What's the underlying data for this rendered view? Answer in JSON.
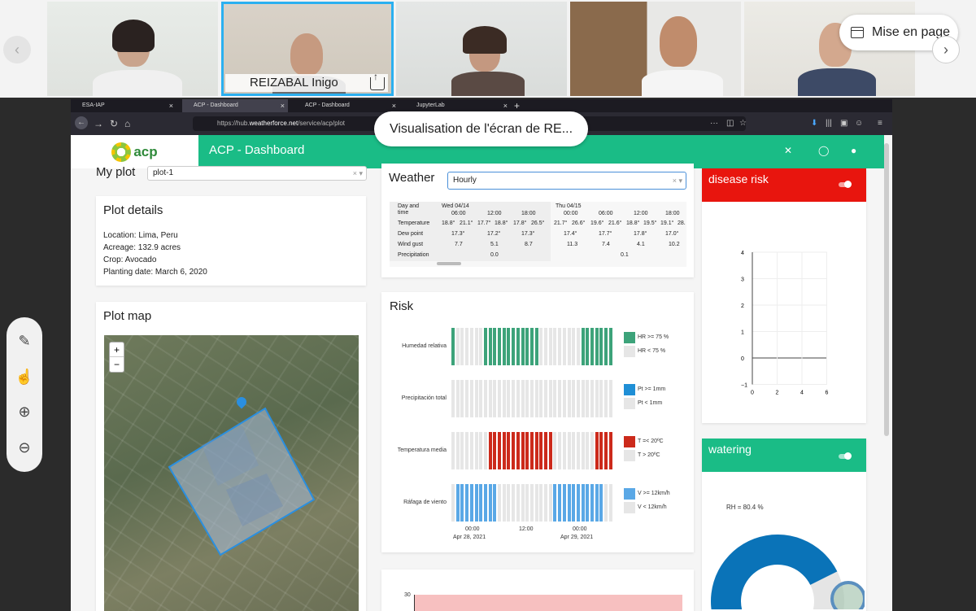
{
  "meeting": {
    "participants": [
      {
        "name": ""
      },
      {
        "name": "REIZABAL Inigo"
      },
      {
        "name": ""
      },
      {
        "name": ""
      },
      {
        "name": ""
      }
    ],
    "layout_button": "Mise en page",
    "share_callout": "Visualisation de l'écran de RE..."
  },
  "browser": {
    "tabs": [
      "ESA-IAP",
      "ACP - Dashboard",
      "ACP - Dashboard",
      "JupyterLab"
    ],
    "url_prefix": "https://hub.",
    "url_host": "weatherforce.net",
    "url_path": "/service/acp/plot"
  },
  "app": {
    "logo_text": "acp",
    "title": "ACP - Dashboard",
    "my_plot_label": "My plot",
    "plot_select": "plot-1",
    "plot_details": {
      "title": "Plot details",
      "location": "Location: Lima, Peru",
      "acreage": "Acreage: 132.9 acres",
      "crop": "Crop: Avocado",
      "planting": "Planting date: March 6, 2020"
    },
    "plot_map": {
      "title": "Plot map",
      "zoom_in": "+",
      "zoom_out": "−"
    },
    "weather": {
      "title": "Weather",
      "select": "Hourly",
      "day_label": "Day and",
      "time_label": "time",
      "days": [
        "Wed 04/14",
        "Thu 04/15"
      ],
      "times": [
        "06:00",
        "12:00",
        "18:00",
        "00:00",
        "06:00",
        "12:00",
        "18:00"
      ],
      "rows": [
        {
          "label": "Temperature",
          "cells": [
            "18.8°",
            "21.1°",
            "17.7°",
            "18.8°",
            "17.8°",
            "26.5°",
            "21.7°",
            "26.6°",
            "19.6°",
            "21.6°",
            "18.8°",
            "19.5°",
            "19.1°",
            "28."
          ]
        },
        {
          "label": "Dew point",
          "cells": [
            "17.3°",
            "17.2°",
            "17.3°",
            "17.4°",
            "17.7°",
            "17.8°",
            "17.0°"
          ]
        },
        {
          "label": "Wind gust",
          "cells": [
            "7.7",
            "5.1",
            "8.7",
            "11.3",
            "7.4",
            "4.1",
            "10.2"
          ]
        },
        {
          "label": "Precipitation",
          "cells": [
            "0.0",
            "0.1"
          ]
        }
      ]
    },
    "risk": {
      "title": "Risk",
      "rows": [
        {
          "label": "Humedad relativa",
          "color": "#3da37a",
          "legend": [
            "HR >= 75 %",
            "HR < 75 %"
          ]
        },
        {
          "label": "Precipitación total",
          "color": "#1f8fd6",
          "legend": [
            "Pt >= 1mm",
            "Pt < 1mm"
          ]
        },
        {
          "label": "Temperatura media",
          "color": "#cc2a1b",
          "legend": [
            "T =< 20ºC",
            "T > 20ºC"
          ]
        },
        {
          "label": "Ráfaga de viento",
          "color": "#5aa8e6",
          "legend": [
            "V >= 12km/h",
            "V < 12km/h"
          ]
        }
      ],
      "x_ticks": [
        {
          "time": "00:00",
          "date": "Apr 28, 2021"
        },
        {
          "time": "12:00",
          "date": ""
        },
        {
          "time": "00:00",
          "date": "Apr 29, 2021"
        }
      ]
    },
    "disease_risk": {
      "title": "disease risk",
      "header_color": "#e8150e",
      "y_ticks": [
        "4",
        "3",
        "2",
        "1",
        "0",
        "−1"
      ],
      "x_ticks": [
        "0",
        "2",
        "4",
        "6"
      ]
    },
    "watering": {
      "title": "watering",
      "header_color": "#1abc86",
      "gauge_label": "RH = 80.4 %",
      "value_percent": 80.4
    },
    "bottom_chart": {
      "y_tick": "30"
    }
  }
}
